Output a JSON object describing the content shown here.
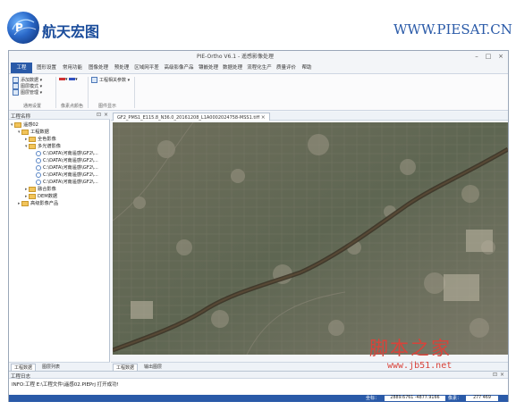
{
  "banner": {
    "logo_text": "航天宏图",
    "url": "WWW.PIESAT.CN"
  },
  "window": {
    "title": "PIE-Ortho V6.1 - 遥感影像处理",
    "minimize": "–",
    "restore": "□",
    "close": "×"
  },
  "ribbon": {
    "tabs": [
      "工程",
      "图形设置",
      "常用功能",
      "图像处理",
      "预处理",
      "区域网平差",
      "高级影像产品",
      "镶嵌处理",
      "数据处理",
      "流程化生产",
      "质量评价",
      "帮助"
    ],
    "active_tab": "工程",
    "group1": {
      "items": [
        "添加数据",
        "图层模式",
        "图层管理"
      ],
      "label": "通用设置"
    },
    "group2": {
      "label": "像素点颜色",
      "colors": [
        "#d03030",
        "#3050c0"
      ]
    },
    "group3": {
      "items": [
        "工程相关参数"
      ],
      "label": "图件显示"
    }
  },
  "left_panel": {
    "title": "工程名称",
    "tree": [
      {
        "level": 0,
        "toggle": "▾",
        "type": "folder",
        "label": "遥感02"
      },
      {
        "level": 1,
        "toggle": "▾",
        "type": "folder",
        "label": "工程数据"
      },
      {
        "level": 2,
        "toggle": "▸",
        "type": "folder",
        "label": "全色影像"
      },
      {
        "level": 2,
        "toggle": "▾",
        "type": "folder",
        "label": "多光谱影像"
      },
      {
        "level": 3,
        "toggle": "",
        "type": "file",
        "label": "C:\\DATA\\河南遥感\\GF2\\..."
      },
      {
        "level": 3,
        "toggle": "",
        "type": "file",
        "label": "C:\\DATA\\河南遥感\\GF2\\..."
      },
      {
        "level": 3,
        "toggle": "",
        "type": "file",
        "label": "C:\\DATA\\河南遥感\\GF2\\..."
      },
      {
        "level": 3,
        "toggle": "",
        "type": "file",
        "label": "C:\\DATA\\河南遥感\\GF2\\..."
      },
      {
        "level": 3,
        "toggle": "",
        "type": "file",
        "label": "C:\\DATA\\河南遥感\\GF2\\..."
      },
      {
        "level": 2,
        "toggle": "▸",
        "type": "folder",
        "label": "融合影像"
      },
      {
        "level": 2,
        "toggle": "▸",
        "type": "folder",
        "label": "DEM数据"
      },
      {
        "level": 1,
        "toggle": "▸",
        "type": "folder",
        "label": "高级影像产品"
      }
    ],
    "bottom_tabs": [
      "工程数据",
      "图层列表"
    ]
  },
  "map": {
    "doc_tab": "GF2_PMS1_E115.8_N36.0_20161208_L1A0002024758-MSS1.tiff",
    "bottom_tabs": [
      "工程数据",
      "输出图层"
    ]
  },
  "log": {
    "title": "工程日志",
    "line": "INFO:工程 E:\\工程文件\\遥感02.PIEPrj 打开成功!"
  },
  "status": {
    "coord_label": "坐标：",
    "coord_value": "2889.6761  -4877.9166",
    "pixel_label": "像素：",
    "pixel_value": "277  469"
  },
  "watermark": {
    "text": "脚本之家",
    "url": "www.jb51.net"
  },
  "colors": {
    "brand_blue": "#2a5aa8",
    "watermark_red": "#d8433a"
  }
}
